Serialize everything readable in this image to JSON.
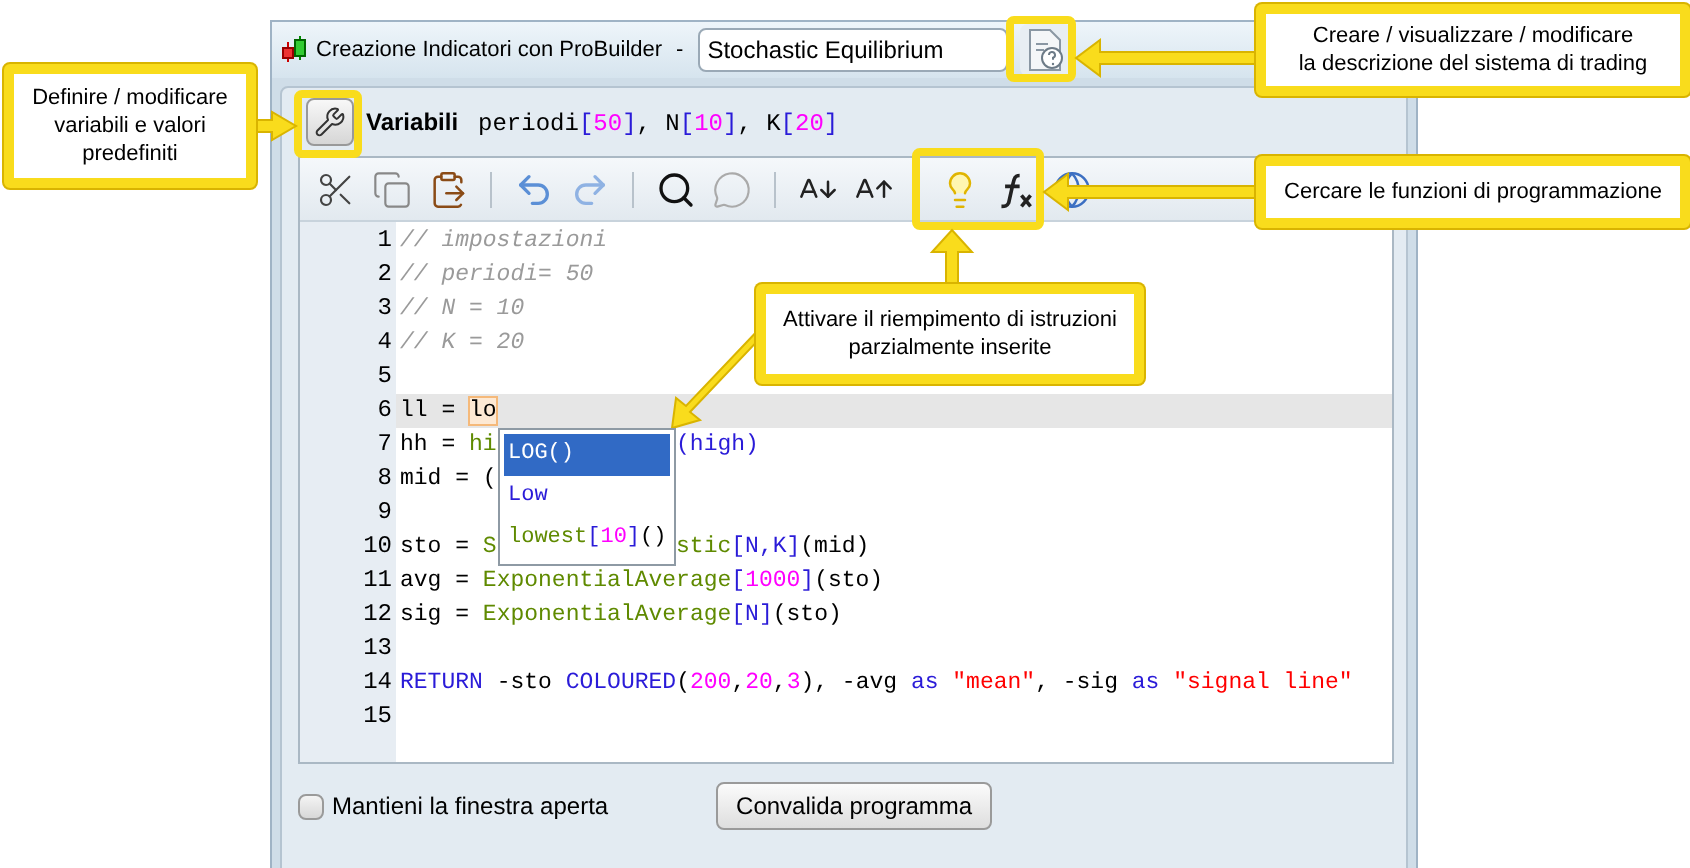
{
  "window": {
    "title": "Creazione Indicatori con ProBuilder",
    "separator": "-",
    "name_field": {
      "value": "Stochastic Equilibrium"
    }
  },
  "variables": {
    "label": "Variabili",
    "tokens": [
      {
        "kind": "plain",
        "text": "periodi"
      },
      {
        "kind": "keyword",
        "text": "["
      },
      {
        "kind": "number",
        "text": "50"
      },
      {
        "kind": "keyword",
        "text": "]"
      },
      {
        "kind": "plain",
        "text": ", N"
      },
      {
        "kind": "keyword",
        "text": "["
      },
      {
        "kind": "number",
        "text": "10"
      },
      {
        "kind": "keyword",
        "text": "]"
      },
      {
        "kind": "plain",
        "text": ", K"
      },
      {
        "kind": "keyword",
        "text": "["
      },
      {
        "kind": "number",
        "text": "20"
      },
      {
        "kind": "keyword",
        "text": "]"
      }
    ]
  },
  "editor": {
    "lines": [
      {
        "number": "1",
        "current": false,
        "tokens": [
          {
            "kind": "comment",
            "text": "// impostazioni"
          }
        ]
      },
      {
        "number": "2",
        "current": false,
        "tokens": [
          {
            "kind": "comment",
            "text": "// periodi= 50"
          }
        ]
      },
      {
        "number": "3",
        "current": false,
        "tokens": [
          {
            "kind": "comment",
            "text": "// N = 10"
          }
        ]
      },
      {
        "number": "4",
        "current": false,
        "tokens": [
          {
            "kind": "comment",
            "text": "// K = 20"
          }
        ]
      },
      {
        "number": "5",
        "current": false
      },
      {
        "number": "6",
        "current": true,
        "tokens": [
          {
            "kind": "plain",
            "text": "ll = "
          },
          {
            "kind": "typed",
            "text": "lo"
          }
        ]
      },
      {
        "number": "7",
        "current": false,
        "tokens": [
          {
            "kind": "plain",
            "text": "hh = "
          },
          {
            "kind": "function",
            "text": "hi"
          },
          {
            "kind": "covered"
          },
          {
            "kind": "keyword",
            "text": "(high)"
          }
        ]
      },
      {
        "number": "8",
        "current": false,
        "tokens": [
          {
            "kind": "plain",
            "text": "mid = ("
          }
        ]
      },
      {
        "number": "9",
        "current": false
      },
      {
        "number": "10",
        "current": false,
        "tokens": [
          {
            "kind": "plain",
            "text": "sto = "
          },
          {
            "kind": "function",
            "text": "S"
          },
          {
            "kind": "covered"
          },
          {
            "kind": "function",
            "text": "stic"
          },
          {
            "kind": "keyword",
            "text": "[N,K]"
          },
          {
            "kind": "plain",
            "text": "(mid)"
          }
        ]
      },
      {
        "number": "11",
        "current": false,
        "tokens": [
          {
            "kind": "plain",
            "text": "avg = "
          },
          {
            "kind": "function",
            "text": "ExponentialAverage"
          },
          {
            "kind": "keyword",
            "text": "["
          },
          {
            "kind": "number",
            "text": "1000"
          },
          {
            "kind": "keyword",
            "text": "]"
          },
          {
            "kind": "plain",
            "text": "(sto)"
          }
        ]
      },
      {
        "number": "12",
        "current": false,
        "tokens": [
          {
            "kind": "plain",
            "text": "sig = "
          },
          {
            "kind": "function",
            "text": "ExponentialAverage"
          },
          {
            "kind": "keyword",
            "text": "[N]"
          },
          {
            "kind": "plain",
            "text": "(sto)"
          }
        ]
      },
      {
        "number": "13",
        "current": false
      },
      {
        "number": "14",
        "current": false,
        "tokens": [
          {
            "kind": "keyword",
            "text": "RETURN"
          },
          {
            "kind": "plain",
            "text": " -sto "
          },
          {
            "kind": "keyword",
            "text": "COLOURED"
          },
          {
            "kind": "plain",
            "text": "("
          },
          {
            "kind": "number",
            "text": "200"
          },
          {
            "kind": "plain",
            "text": ","
          },
          {
            "kind": "number",
            "text": "20"
          },
          {
            "kind": "plain",
            "text": ","
          },
          {
            "kind": "number",
            "text": "3"
          },
          {
            "kind": "plain",
            "text": "), -avg "
          },
          {
            "kind": "keyword",
            "text": "as"
          },
          {
            "kind": "string",
            "text": " \"mean\""
          },
          {
            "kind": "plain",
            "text": ", -sig "
          },
          {
            "kind": "keyword",
            "text": "as"
          },
          {
            "kind": "string",
            "text": " \"signal line\""
          }
        ]
      },
      {
        "number": "15",
        "current": false
      }
    ]
  },
  "autocomplete": {
    "items": [
      {
        "selected": true,
        "tokens": [
          {
            "kind": "plain",
            "text": "LOG()"
          }
        ]
      },
      {
        "selected": false,
        "tokens": [
          {
            "kind": "keyword",
            "text": "Low"
          }
        ]
      },
      {
        "selected": false,
        "tokens": [
          {
            "kind": "function",
            "text": "lowest"
          },
          {
            "kind": "keyword",
            "text": "["
          },
          {
            "kind": "number",
            "text": "10"
          },
          {
            "kind": "keyword",
            "text": "]"
          },
          {
            "kind": "plain",
            "text": "()"
          }
        ]
      }
    ]
  },
  "footer": {
    "keep_open": {
      "label": "Mantieni la finestra aperta",
      "checked": false
    },
    "validate_button": "Convalida programma"
  },
  "callouts": [
    {
      "text": "Definire / modificare\nvariabili e valori\npredefiniti"
    },
    {
      "text": "Creare / visualizzare / modificare\nla descrizione del sistema di trading"
    },
    {
      "text": "Cercare le funzioni di programmazione"
    },
    {
      "text": "Attivare il riempimento di istruzioni\nparzialmente inserite"
    }
  ]
}
